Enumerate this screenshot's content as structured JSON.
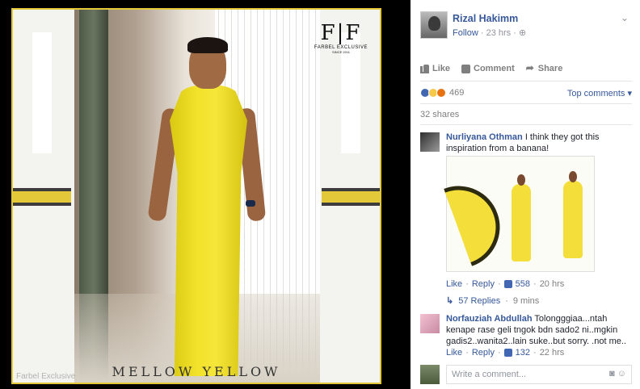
{
  "photo": {
    "logo_text": "F|F",
    "logo_brand": "FARBEL EXCLUSIVE",
    "logo_since": "SINCE 2011",
    "caption": "MELLOW YELLOW",
    "watermark": "Farbel Exclusive",
    "accent_color": "#e3c93a"
  },
  "post": {
    "author": "Rizal Hakimm",
    "follow_label": "Follow",
    "timestamp": "23 hrs",
    "privacy_icon": "globe-icon",
    "actions": {
      "like": "Like",
      "comment": "Comment",
      "share": "Share"
    },
    "reaction_count": "469",
    "top_comments_label": "Top comments ▾",
    "shares": "32 shares"
  },
  "comments": [
    {
      "name": "Nurliyana Othman",
      "text": "I think they got this inspiration from a banana!",
      "like": "Like",
      "reply": "Reply",
      "likes": "558",
      "time": "20 hrs",
      "replies_label": "57 Replies",
      "replies_time": "9 mins"
    },
    {
      "name": "Norfauziah Abdullah",
      "text": "Tolongggiaa...ntah kenape rase geli tngok bdn sado2 ni..mgkin gadis2..wanita2..lain suke..but sorry. .not me..",
      "like": "Like",
      "reply": "Reply",
      "likes": "132",
      "time": "22 hrs"
    }
  ],
  "write_comment": {
    "placeholder": "Write a comment...",
    "icons": "camera-icon smiley-icon"
  }
}
